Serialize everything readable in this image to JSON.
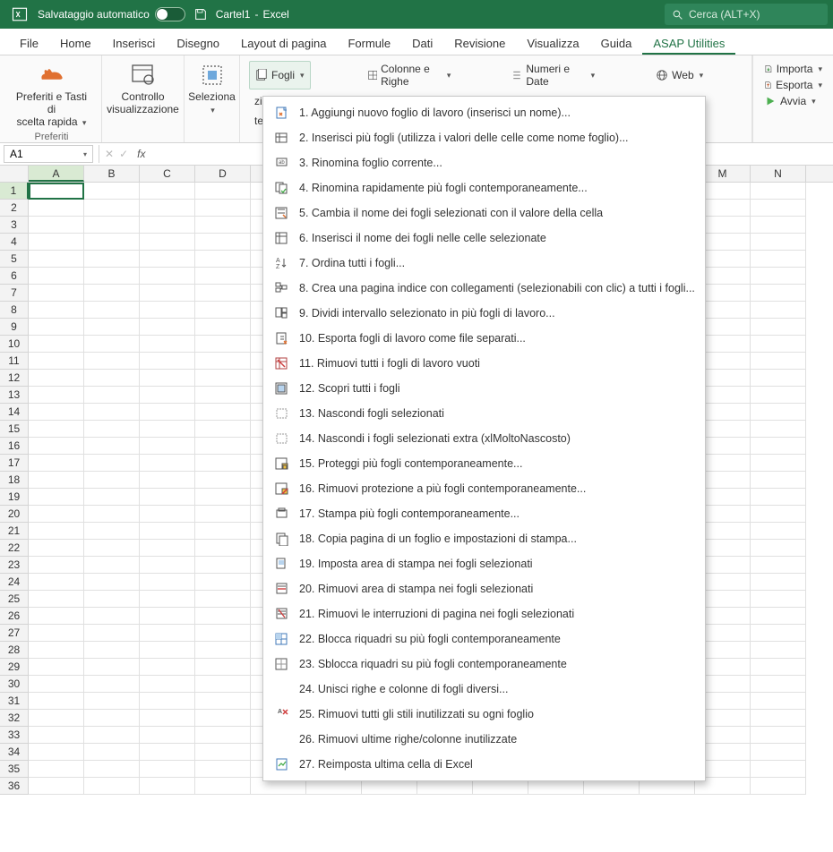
{
  "titlebar": {
    "autosave_label": "Salvataggio automatico",
    "doc": "Cartel1",
    "sep": "-",
    "app": "Excel",
    "search_placeholder": "Cerca (ALT+X)"
  },
  "tabs": {
    "file": "File",
    "home": "Home",
    "inserisci": "Inserisci",
    "disegno": "Disegno",
    "layout": "Layout di pagina",
    "formule": "Formule",
    "dati": "Dati",
    "revisione": "Revisione",
    "visualizza": "Visualizza",
    "guida": "Guida",
    "asap": "ASAP Utilities"
  },
  "ribbon": {
    "preferiti_btn_l1": "Preferiti e Tasti di",
    "preferiti_btn_l2": "scelta rapida",
    "preferiti_group": "Preferiti",
    "controllo_l1": "Controllo",
    "controllo_l2": "visualizzazione",
    "seleziona": "Seleziona",
    "fogli": "Fogli",
    "colonne": "Colonne e Righe",
    "numeri": "Numeri e Date",
    "web": "Web",
    "zioni": "zioni",
    "tema": "tema",
    "importa": "Importa",
    "esporta": "Esporta",
    "avvia": "Avvia"
  },
  "namebox": {
    "value": "A1"
  },
  "columns": [
    "A",
    "B",
    "C",
    "D",
    "",
    "",
    "",
    "",
    "",
    "",
    "",
    "",
    "M",
    "N"
  ],
  "row_count": 36,
  "menu": [
    {
      "n": "1",
      "t": "Aggiungi nuovo foglio di lavoro (inserisci un nome)..."
    },
    {
      "n": "2",
      "t": "Inserisci più fogli (utilizza i valori delle celle come nome foglio)..."
    },
    {
      "n": "3",
      "t": "Rinomina foglio corrente..."
    },
    {
      "n": "4",
      "t": "Rinomina rapidamente più fogli contemporaneamente..."
    },
    {
      "n": "5",
      "t": "Cambia il nome dei fogli selezionati con il valore della cella"
    },
    {
      "n": "6",
      "t": "Inserisci il nome dei fogli nelle celle selezionate"
    },
    {
      "n": "7",
      "t": "Ordina tutti i fogli..."
    },
    {
      "n": "8",
      "t": "Crea una pagina indice con collegamenti (selezionabili con clic) a tutti i fogli..."
    },
    {
      "n": "9",
      "t": "Dividi intervallo selezionato in più fogli di lavoro..."
    },
    {
      "n": "10",
      "t": "Esporta fogli di lavoro come file separati..."
    },
    {
      "n": "11",
      "t": "Rimuovi tutti i fogli di lavoro vuoti"
    },
    {
      "n": "12",
      "t": "Scopri tutti i fogli"
    },
    {
      "n": "13",
      "t": "Nascondi fogli selezionati"
    },
    {
      "n": "14",
      "t": "Nascondi i fogli selezionati extra (xlMoltoNascosto)"
    },
    {
      "n": "15",
      "t": "Proteggi più fogli contemporaneamente..."
    },
    {
      "n": "16",
      "t": "Rimuovi protezione a più fogli contemporaneamente..."
    },
    {
      "n": "17",
      "t": "Stampa più fogli contemporaneamente..."
    },
    {
      "n": "18",
      "t": "Copia pagina di un foglio e impostazioni di stampa..."
    },
    {
      "n": "19",
      "t": "Imposta area di stampa nei fogli selezionati"
    },
    {
      "n": "20",
      "t": "Rimuovi area di stampa nei fogli selezionati"
    },
    {
      "n": "21",
      "t": "Rimuovi le interruzioni di pagina nei fogli selezionati"
    },
    {
      "n": "22",
      "t": "Blocca riquadri su più fogli contemporaneamente"
    },
    {
      "n": "23",
      "t": "Sblocca riquadri su più fogli contemporaneamente"
    },
    {
      "n": "24",
      "t": "Unisci righe e colonne di fogli diversi..."
    },
    {
      "n": "25",
      "t": "Rimuovi tutti gli stili inutilizzati su ogni foglio"
    },
    {
      "n": "26",
      "t": "Rimuovi ultime righe/colonne inutilizzate"
    },
    {
      "n": "27",
      "t": "Reimposta ultima cella di Excel"
    }
  ]
}
